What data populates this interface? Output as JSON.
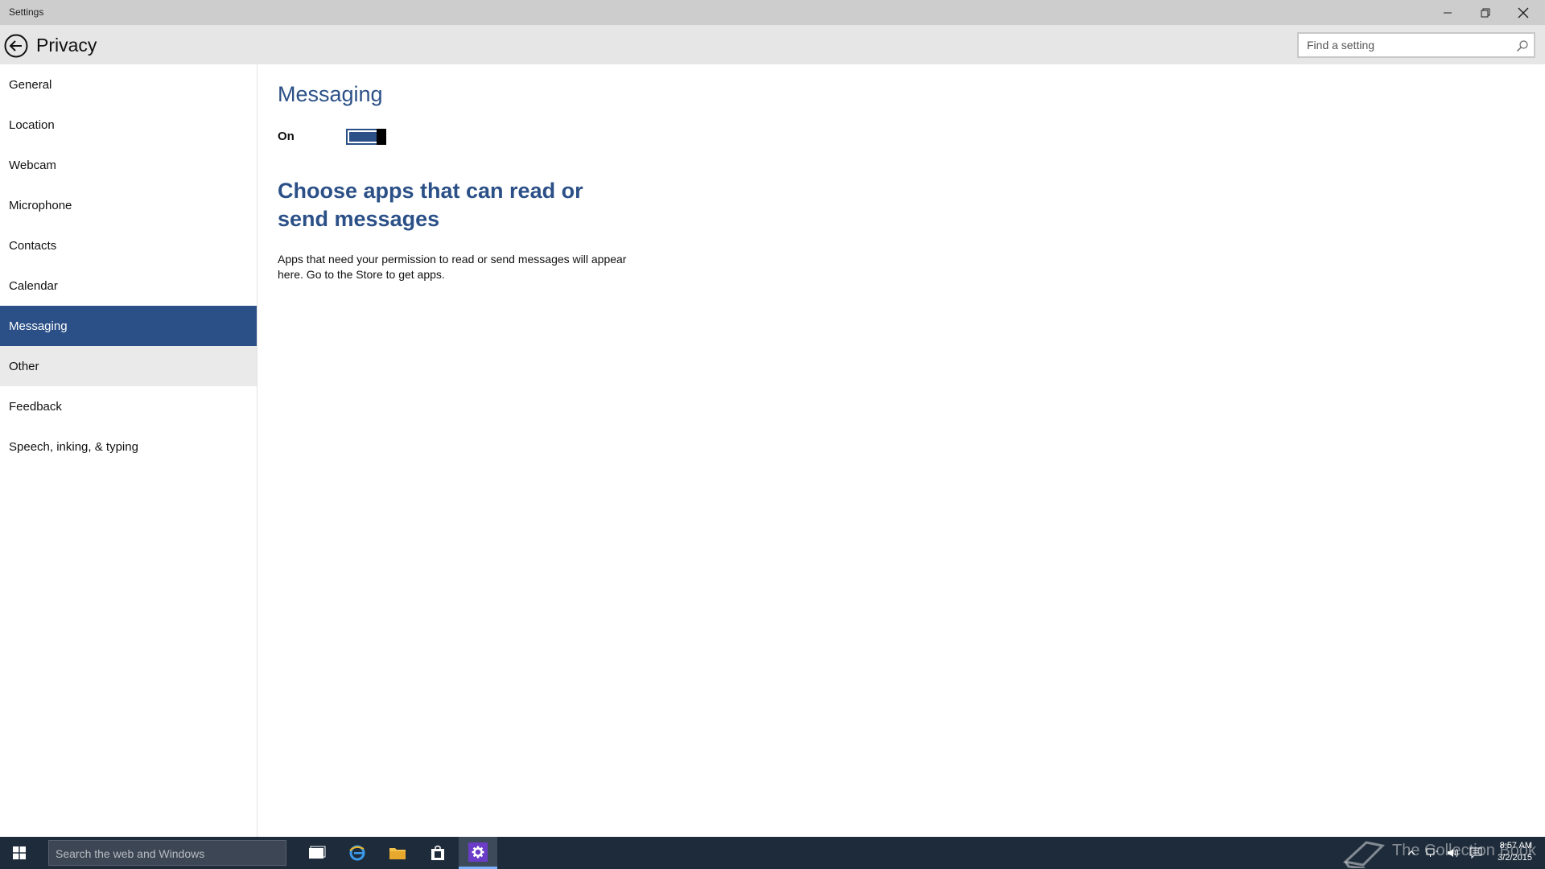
{
  "window": {
    "title": "Settings"
  },
  "header": {
    "title": "Privacy",
    "search_placeholder": "Find a setting"
  },
  "sidebar": {
    "items": [
      {
        "label": "General"
      },
      {
        "label": "Location"
      },
      {
        "label": "Webcam"
      },
      {
        "label": "Microphone"
      },
      {
        "label": "Contacts"
      },
      {
        "label": "Calendar"
      },
      {
        "label": "Messaging"
      },
      {
        "label": "Other"
      },
      {
        "label": "Feedback"
      },
      {
        "label": "Speech, inking, & typing"
      }
    ],
    "active": "Messaging",
    "hovered": "Other"
  },
  "main": {
    "section_title": "Messaging",
    "toggle": {
      "label": "On",
      "state": true
    },
    "apps_heading": "Choose apps that can read or send messages",
    "apps_description": "Apps that need your permission to read or send messages will appear here. Go to the Store to get apps."
  },
  "taskbar": {
    "search_placeholder": "Search the web and Windows",
    "time": "8:57 AM",
    "date": "3/2/2015",
    "watermark": "The Collection Book",
    "apps": [
      "task-view-icon",
      "edge-icon",
      "file-explorer-icon",
      "store-icon",
      "settings-icon"
    ]
  },
  "colors": {
    "accent": "#2b5087",
    "taskbar": "#1e2b3a",
    "titlebar": "#cdcdcd",
    "header": "#e6e6e6"
  }
}
